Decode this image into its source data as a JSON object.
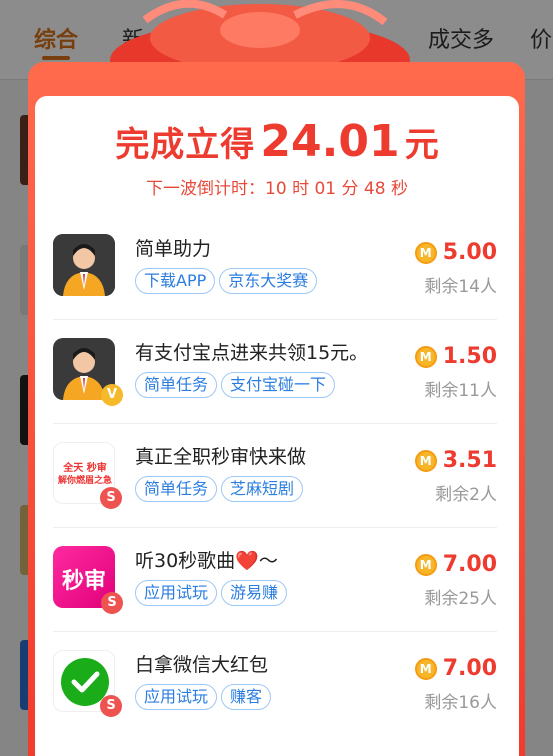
{
  "background": {
    "tabs": [
      {
        "label": "综合",
        "active": true
      },
      {
        "label": "新"
      },
      {
        "label": "成交多"
      },
      {
        "label": "价"
      }
    ]
  },
  "modal": {
    "title_label": "完成立得",
    "title_amount": "24.01",
    "title_unit": "元",
    "countdown": "下一波倒计时：10 时 01 分 48 秒",
    "tasks": [
      {
        "name": "简单助力",
        "tags": [
          "下载APP",
          "京东大奖赛"
        ],
        "reward": "5.00",
        "remaining": "剩余14人",
        "icon": "avatar-icon"
      },
      {
        "name": "有支付宝点进来共领15元。",
        "tags": [
          "简单任务",
          "支付宝碰一下"
        ],
        "reward": "1.50",
        "remaining": "剩余11人",
        "icon": "avatar-verified-icon"
      },
      {
        "name": "真正全职秒审快来做",
        "tags": [
          "简单任务",
          "芝麻短剧"
        ],
        "reward": "3.51",
        "remaining": "剩余2人",
        "icon": "fulltime-review-icon",
        "icon_text_1": "全天 秒审",
        "icon_text_2": "解你燃眉之急"
      },
      {
        "name": "听30秒歌曲❤️～",
        "tags": [
          "应用试玩",
          "游易赚"
        ],
        "reward": "7.00",
        "remaining": "剩余25人",
        "icon": "second-review-icon",
        "icon_text": "秒审"
      },
      {
        "name": "白拿微信大红包",
        "tags": [
          "应用试玩",
          "赚客"
        ],
        "reward": "7.00",
        "remaining": "剩余16人",
        "icon": "wechat-icon"
      }
    ],
    "coin_symbol": "M",
    "badge_symbol": "S",
    "verified_symbol": "V"
  },
  "colors": {
    "accent_red": "#ee3b2f",
    "tag_blue": "#2b7de0",
    "tab_active": "#d9741a"
  }
}
